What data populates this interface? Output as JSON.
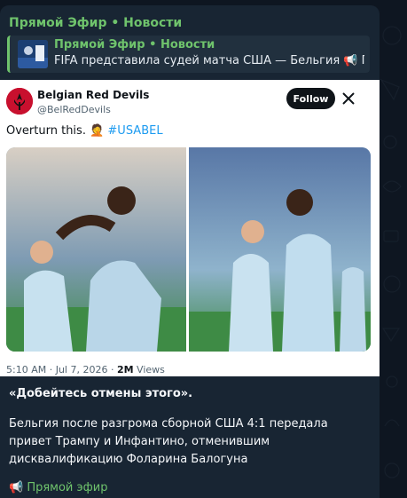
{
  "post": {
    "channel_name": "Прямой Эфир • Новости",
    "reply": {
      "title": "Прямой Эфир • Новости",
      "text": "FIFA представила судей матча США — Бельгия  📢 Пря..."
    },
    "tweet": {
      "author_name": "Belgian Red Devils",
      "author_handle": "@BelRedDevils",
      "follow_label": "Follow",
      "text_plain": "Overturn this. 🤦",
      "hashtag": "#USABEL",
      "timestamp": "5:10 AM · Jul 7, 2026 · ",
      "views_count": "2M",
      "views_label": " Views"
    },
    "quote": "«Добейтесь отмены этого».",
    "body": "Бельгия после разгрома сборной США 4:1 передала привет Трампу и Инфантино, отменившим дисквалификацию Фоларина Балогуна",
    "footer_link": "📢 Прямой эфир"
  }
}
